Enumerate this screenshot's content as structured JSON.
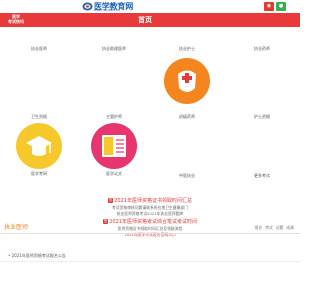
{
  "header": {
    "logo_text": "医学教育网",
    "logo_url": "www.med66.com",
    "brand_line1": "医学",
    "brand_line2": "考试快讯",
    "nav_title": "首页",
    "icons": [
      "weibo-icon",
      "wechat-icon"
    ]
  },
  "tiles": [
    {
      "key": "doctor",
      "label": "执业医师"
    },
    {
      "key": "assistant",
      "label": "执业助理医师"
    },
    {
      "key": "nurse",
      "label": "执业护士"
    },
    {
      "key": "pharmacist",
      "label": "执业药师"
    },
    {
      "key": "health",
      "label": "卫生资格"
    },
    {
      "key": "intermediate",
      "label": "主管护师"
    },
    {
      "key": "chinese",
      "label": "初级药师"
    },
    {
      "key": "nurse_assist",
      "label": "护士资格"
    },
    {
      "key": "student",
      "label": "医学考研"
    },
    {
      "key": "record",
      "label": "医学论文"
    },
    {
      "key": "tcm",
      "label": "中医执业"
    },
    {
      "key": "more",
      "label": "更多考试"
    }
  ],
  "notices": [
    {
      "text": "2021年医师资格证书领取时间汇总",
      "badge": "热",
      "red": true,
      "big": true
    },
    {
      "text": "考试资格审核问题请联系所在地卫生健康部门",
      "red": false
    },
    {
      "text": "执业医师资格考试2021年执业医师题库",
      "red": false
    },
    {
      "text": "2021年医师资格考试综合笔试考试时间",
      "badge": "热",
      "red": true,
      "big": true
    },
    {
      "text": "医师资格证书领取时间汇总及领取流程",
      "red": false
    },
    {
      "text": "2021年医学考试报名官网入口",
      "red": true
    }
  ],
  "section": {
    "title": "执业医师",
    "tabs": [
      "报名",
      "考试",
      "试题",
      "成绩"
    ]
  },
  "list": [
    "2021年医师资格考试报名公告"
  ]
}
